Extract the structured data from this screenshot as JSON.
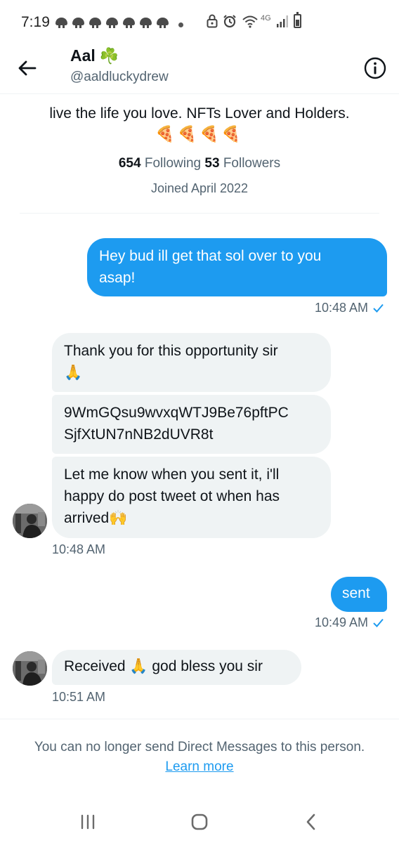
{
  "status_bar": {
    "time": "7:19",
    "network": "4G",
    "notification_icons": [
      "app-icon",
      "app-icon",
      "app-icon",
      "app-icon",
      "app-icon",
      "app-icon",
      "app-icon"
    ],
    "system_icons": [
      "lock-icon",
      "alarm-icon",
      "wifi-icon",
      "signal-icon",
      "battery-icon"
    ]
  },
  "header": {
    "display_name": "Aal",
    "name_emoji": "☘️",
    "handle": "@aaldluckydrew",
    "back_icon": "arrow-left-icon",
    "info_icon": "info-icon"
  },
  "profile": {
    "bio": "live the life you love.  NFTs Lover and Holders.",
    "bio_emoji": "🍕🍕🍕🍕",
    "following_count": "654",
    "following_label": "Following",
    "followers_count": "53",
    "followers_label": "Followers",
    "joined": "Joined April 2022"
  },
  "messages": [
    {
      "direction": "sent",
      "lines": [
        "Hey bud ill get that sol over to you",
        "asap!"
      ],
      "time": "10:48 AM",
      "read": true
    },
    {
      "direction": "received",
      "lines": [
        "Thank you for this opportunity sir",
        "🙏"
      ]
    },
    {
      "direction": "received",
      "lines": [
        "9WmGQsu9wvxqWTJ9Be76pftPC",
        "SjfXtUN7nNB2dUVR8t"
      ]
    },
    {
      "direction": "received",
      "lines": [
        "Let me know when you sent it, i'll",
        "happy do post tweet ot when has",
        "arrived🙌"
      ],
      "time": "10:48 AM"
    },
    {
      "direction": "sent",
      "lines": [
        "sent"
      ],
      "time": "10:49 AM",
      "read": true
    },
    {
      "direction": "received",
      "lines": [
        "Received 🙏 god bless you sir"
      ],
      "time": "10:51 AM"
    }
  ],
  "footer": {
    "notice": "You can no longer send Direct Messages to this person.",
    "learn_more": "Learn more"
  },
  "nav": {
    "recent_icon": "recent-apps-icon",
    "home_icon": "home-icon",
    "back_icon": "back-icon"
  },
  "colors": {
    "accent": "#1d9bf0",
    "received_bubble": "#eff3f4",
    "secondary_text": "#536471"
  }
}
